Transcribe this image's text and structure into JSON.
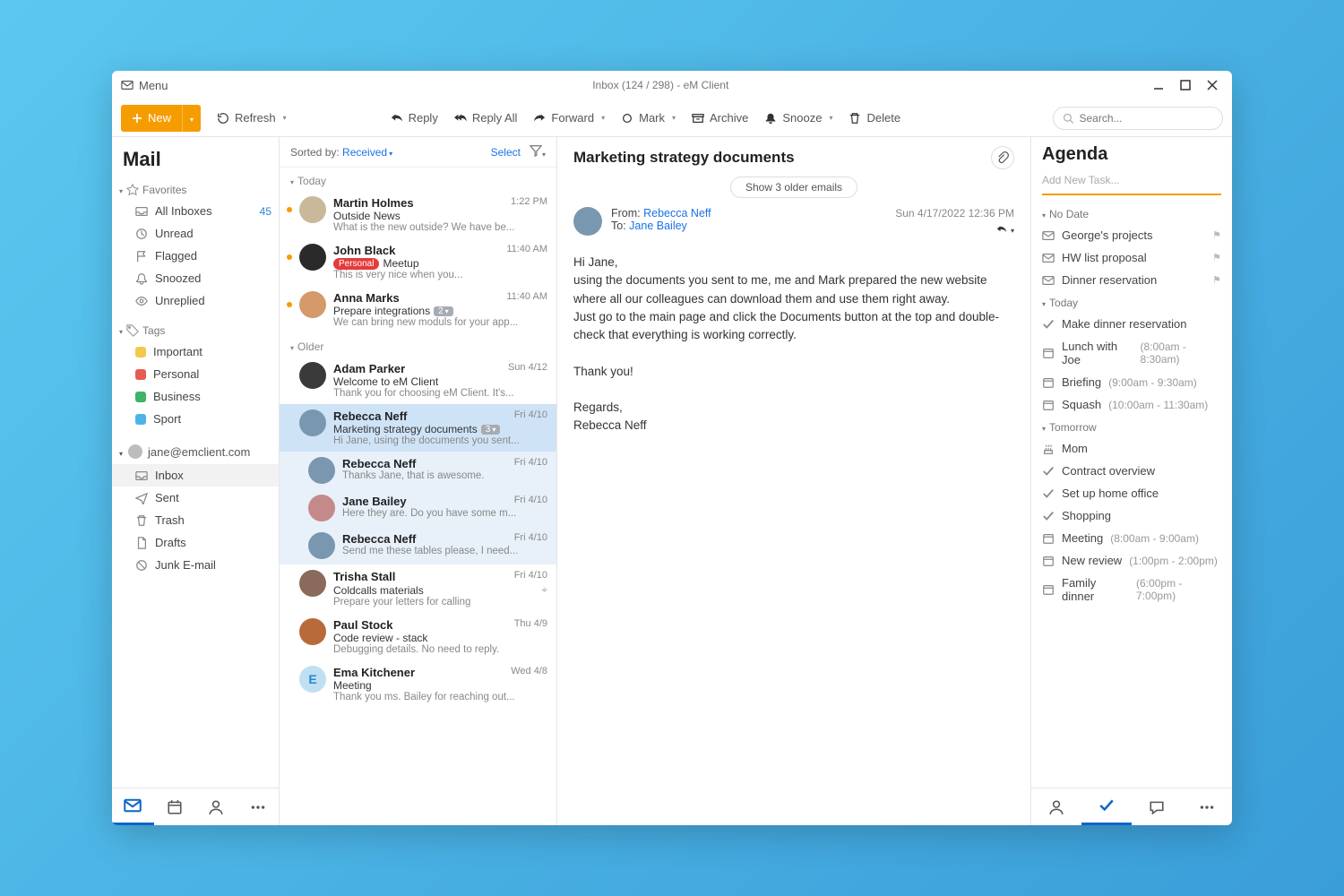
{
  "titlebar": {
    "menu": "Menu",
    "title": "Inbox (124 / 298) - eM Client"
  },
  "toolbar": {
    "new": "New",
    "refresh": "Refresh",
    "reply": "Reply",
    "reply_all": "Reply All",
    "forward": "Forward",
    "mark": "Mark",
    "archive": "Archive",
    "snooze": "Snooze",
    "delete": "Delete",
    "search_placeholder": "Search..."
  },
  "sidebar": {
    "title": "Mail",
    "favorites_label": "Favorites",
    "favorites": [
      {
        "label": "All Inboxes",
        "count": "45",
        "icon": "inbox"
      },
      {
        "label": "Unread",
        "icon": "clock"
      },
      {
        "label": "Flagged",
        "icon": "flag"
      },
      {
        "label": "Snoozed",
        "icon": "bell"
      },
      {
        "label": "Unreplied",
        "icon": "eye"
      }
    ],
    "tags_label": "Tags",
    "tags": [
      {
        "label": "Important",
        "color": "#f3c84d"
      },
      {
        "label": "Personal",
        "color": "#e85b55"
      },
      {
        "label": "Business",
        "color": "#3fb26b"
      },
      {
        "label": "Sport",
        "color": "#4fb3e8"
      }
    ],
    "account": "jane@emclient.com",
    "folders": [
      {
        "label": "Inbox",
        "selected": true,
        "icon": "inbox"
      },
      {
        "label": "Sent",
        "icon": "send"
      },
      {
        "label": "Trash",
        "icon": "trash"
      },
      {
        "label": "Drafts",
        "icon": "doc"
      },
      {
        "label": "Junk E-mail",
        "icon": "junk"
      }
    ]
  },
  "msglist": {
    "sorted_by_label": "Sorted by:",
    "sorted_by_value": "Received",
    "select": "Select",
    "groups": [
      {
        "label": "Today",
        "messages": [
          {
            "unread": true,
            "avatar_color": "#c9b89a",
            "from": "Martin Holmes",
            "subject": "Outside News",
            "preview": "What is the new outside? We have be...",
            "date": "1:22 PM"
          },
          {
            "unread": true,
            "avatar_color": "#2a2a2a",
            "from": "John Black",
            "subject": "Meetup",
            "tag": "Personal",
            "preview": "This is very nice when you...",
            "date": "11:40 AM"
          },
          {
            "unread": true,
            "avatar_color": "#d49a6a",
            "from": "Anna Marks",
            "subject": "Prepare integrations",
            "badge": "2",
            "preview": "We can bring new moduls for your app...",
            "date": "11:40 AM"
          }
        ]
      },
      {
        "label": "Older",
        "messages": [
          {
            "avatar_color": "#3a3a3a",
            "from": "Adam Parker",
            "subject": "Welcome to eM Client",
            "preview": "Thank you for choosing eM Client. It's...",
            "date": "Sun 4/12"
          },
          {
            "selected": "primary",
            "avatar_color": "#7a97b0",
            "from": "Rebecca Neff",
            "subject": "Marketing strategy documents",
            "badge": "3",
            "preview": "Hi Jane, using the documents you sent...",
            "date": "Fri 4/10"
          },
          {
            "selected": "thread",
            "indented": true,
            "avatar_color": "#7a97b0",
            "from": "Rebecca Neff",
            "preview": "Thanks Jane, that is awesome.",
            "date": "Fri 4/10"
          },
          {
            "selected": "thread",
            "indented": true,
            "avatar_color": "#c48a8a",
            "from": "Jane Bailey",
            "preview": "Here they are. Do you have some m...",
            "date": "Fri 4/10"
          },
          {
            "selected": "thread",
            "indented": true,
            "avatar_color": "#7a97b0",
            "from": "Rebecca Neff",
            "preview": "Send me these tables please, I need...",
            "date": "Fri 4/10"
          },
          {
            "avatar_color": "#8a6a5a",
            "from": "Trisha Stall",
            "subject": "Coldcalls materials",
            "crosshair": true,
            "preview": "Prepare your letters for calling",
            "date": "Fri 4/10"
          },
          {
            "avatar_color": "#b86a3a",
            "from": "Paul Stock",
            "subject": "Code review - stack",
            "preview": "Debugging details. No need to reply.",
            "date": "Thu 4/9"
          },
          {
            "avatar_letter": "E",
            "avatar_color": "#bfe0f2",
            "avatar_fg": "#2a84d6",
            "from": "Ema Kitchener",
            "subject": "Meeting",
            "preview": "Thank you ms. Bailey for reaching out...",
            "date": "Wed 4/8"
          }
        ]
      }
    ]
  },
  "reading": {
    "subject": "Marketing strategy documents",
    "older_pill": "Show 3 older emails",
    "from_label": "From:",
    "from": "Rebecca Neff",
    "to_label": "To:",
    "to": "Jane Bailey",
    "date": "Sun 4/17/2022 12:36 PM",
    "body": "Hi Jane,\nusing the documents you sent to me, me and Mark prepared the new website where all our colleagues can download them and use them right away.\nJust go to the main page and click the Documents button at the top and double-check that everything is working correctly.\n\nThank you!\n\nRegards,\nRebecca Neff"
  },
  "agenda": {
    "title": "Agenda",
    "add_task": "Add New Task...",
    "sections": [
      {
        "label": "No Date",
        "items": [
          {
            "icon": "mail",
            "label": "George's projects",
            "flag": true
          },
          {
            "icon": "mail",
            "label": "HW list proposal",
            "flag": true
          },
          {
            "icon": "mail",
            "label": "Dinner reservation",
            "flag": true
          }
        ]
      },
      {
        "label": "Today",
        "items": [
          {
            "icon": "check",
            "label": "Make dinner reservation"
          },
          {
            "icon": "cal",
            "label": "Lunch with Joe",
            "time": "(8:00am - 8:30am)"
          },
          {
            "icon": "cal",
            "label": "Briefing",
            "time": "(9:00am - 9:30am)"
          },
          {
            "icon": "cal",
            "label": "Squash",
            "time": "(10:00am - 11:30am)"
          }
        ]
      },
      {
        "label": "Tomorrow",
        "items": [
          {
            "icon": "cake",
            "label": "Mom"
          },
          {
            "icon": "check",
            "label": "Contract overview"
          },
          {
            "icon": "check",
            "label": "Set up home office"
          },
          {
            "icon": "check",
            "label": "Shopping"
          },
          {
            "icon": "cal",
            "label": "Meeting",
            "time": "(8:00am - 9:00am)"
          },
          {
            "icon": "cal",
            "label": "New review",
            "time": "(1:00pm - 2:00pm)"
          },
          {
            "icon": "cal",
            "label": "Family dinner",
            "time": "(6:00pm - 7:00pm)"
          }
        ]
      }
    ]
  }
}
